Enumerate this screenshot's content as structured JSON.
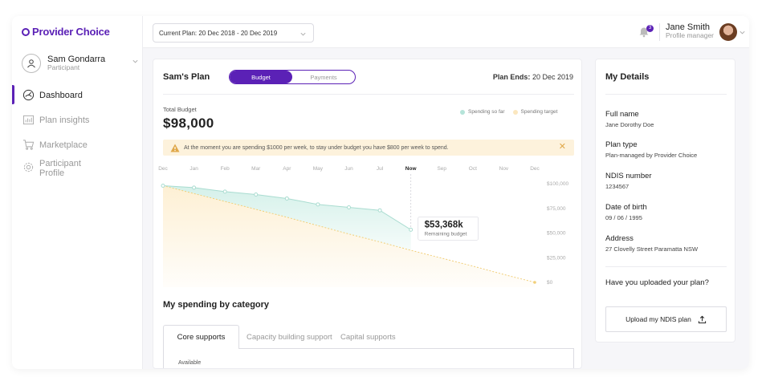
{
  "brand": {
    "name": "Provider Choice",
    "color": "#5b21b6"
  },
  "sidebar": {
    "user": {
      "name": "Sam Gondarra",
      "role": "Participant"
    },
    "items": [
      {
        "label": "Dashboard",
        "icon": "dashboard-icon",
        "active": true
      },
      {
        "label": "Plan insights",
        "icon": "chart-icon",
        "active": false
      },
      {
        "label": "Marketplace",
        "icon": "cart-icon",
        "active": false
      },
      {
        "label": "Participant Profile",
        "icon": "gear-icon",
        "active": false
      }
    ]
  },
  "topbar": {
    "plan_select": "Current Plan: 20 Dec 2018 - 20 Dec 2019",
    "notification_count": "3",
    "user_name": "Jane Smith",
    "user_role": "Profile manager"
  },
  "plan": {
    "title": "Sam's Plan",
    "toggle": [
      "Budget",
      "Payments"
    ],
    "ends_label": "Plan Ends:",
    "ends_value": "20 Dec 2019",
    "total_label": "Total Budget",
    "total_value": "$98,000",
    "legend": [
      {
        "label": "Spending so far",
        "color": "#b5e4d9"
      },
      {
        "label": "Spending target",
        "color": "#fbe7bf"
      }
    ],
    "alert": "At the moment you are spending $1000 per week, to stay under budget you have $800 per week to spend."
  },
  "chart_data": {
    "type": "line",
    "x": [
      "Dec",
      "Jan",
      "Feb",
      "Mar",
      "Apr",
      "May",
      "Jun",
      "Jul",
      "Now",
      "Sep",
      "Oct",
      "Nov",
      "Dec"
    ],
    "series": [
      {
        "name": "Spending so far",
        "values": [
          98000,
          96000,
          92000,
          89000,
          85000,
          79000,
          76000,
          73000,
          53368
        ]
      },
      {
        "name": "Spending target",
        "values": [
          98000,
          90000,
          82000,
          74000,
          66000,
          57500,
          49000,
          41000,
          32500,
          24500,
          16500,
          8000,
          0
        ]
      }
    ],
    "ytick_labels": [
      "$100,000",
      "$75,000",
      "$50,000",
      "$25,000",
      "$0"
    ],
    "ylim": [
      0,
      100000
    ],
    "highlight": {
      "x": "Now",
      "value": "$53,368k",
      "label": "Remaining budget"
    }
  },
  "spending": {
    "title": "My spending by category",
    "tabs": [
      "Core supports",
      "Capacity building support",
      "Capital supports"
    ],
    "available_label": "Available"
  },
  "details": {
    "title": "My Details",
    "fields": [
      {
        "label": "Full name",
        "value": "Jane Dorothy Doe"
      },
      {
        "label": "Plan type",
        "value": "Plan-managed by Provider Choice"
      },
      {
        "label": "NDIS number",
        "value": "1234567"
      },
      {
        "label": "Date of birth",
        "value": "09 / 06 / 1995"
      },
      {
        "label": "Address",
        "value": "27 Clovelly Street Paramatta NSW"
      }
    ],
    "upload_question": "Have you uploaded your plan?",
    "upload_button": "Upload my NDIS plan"
  }
}
